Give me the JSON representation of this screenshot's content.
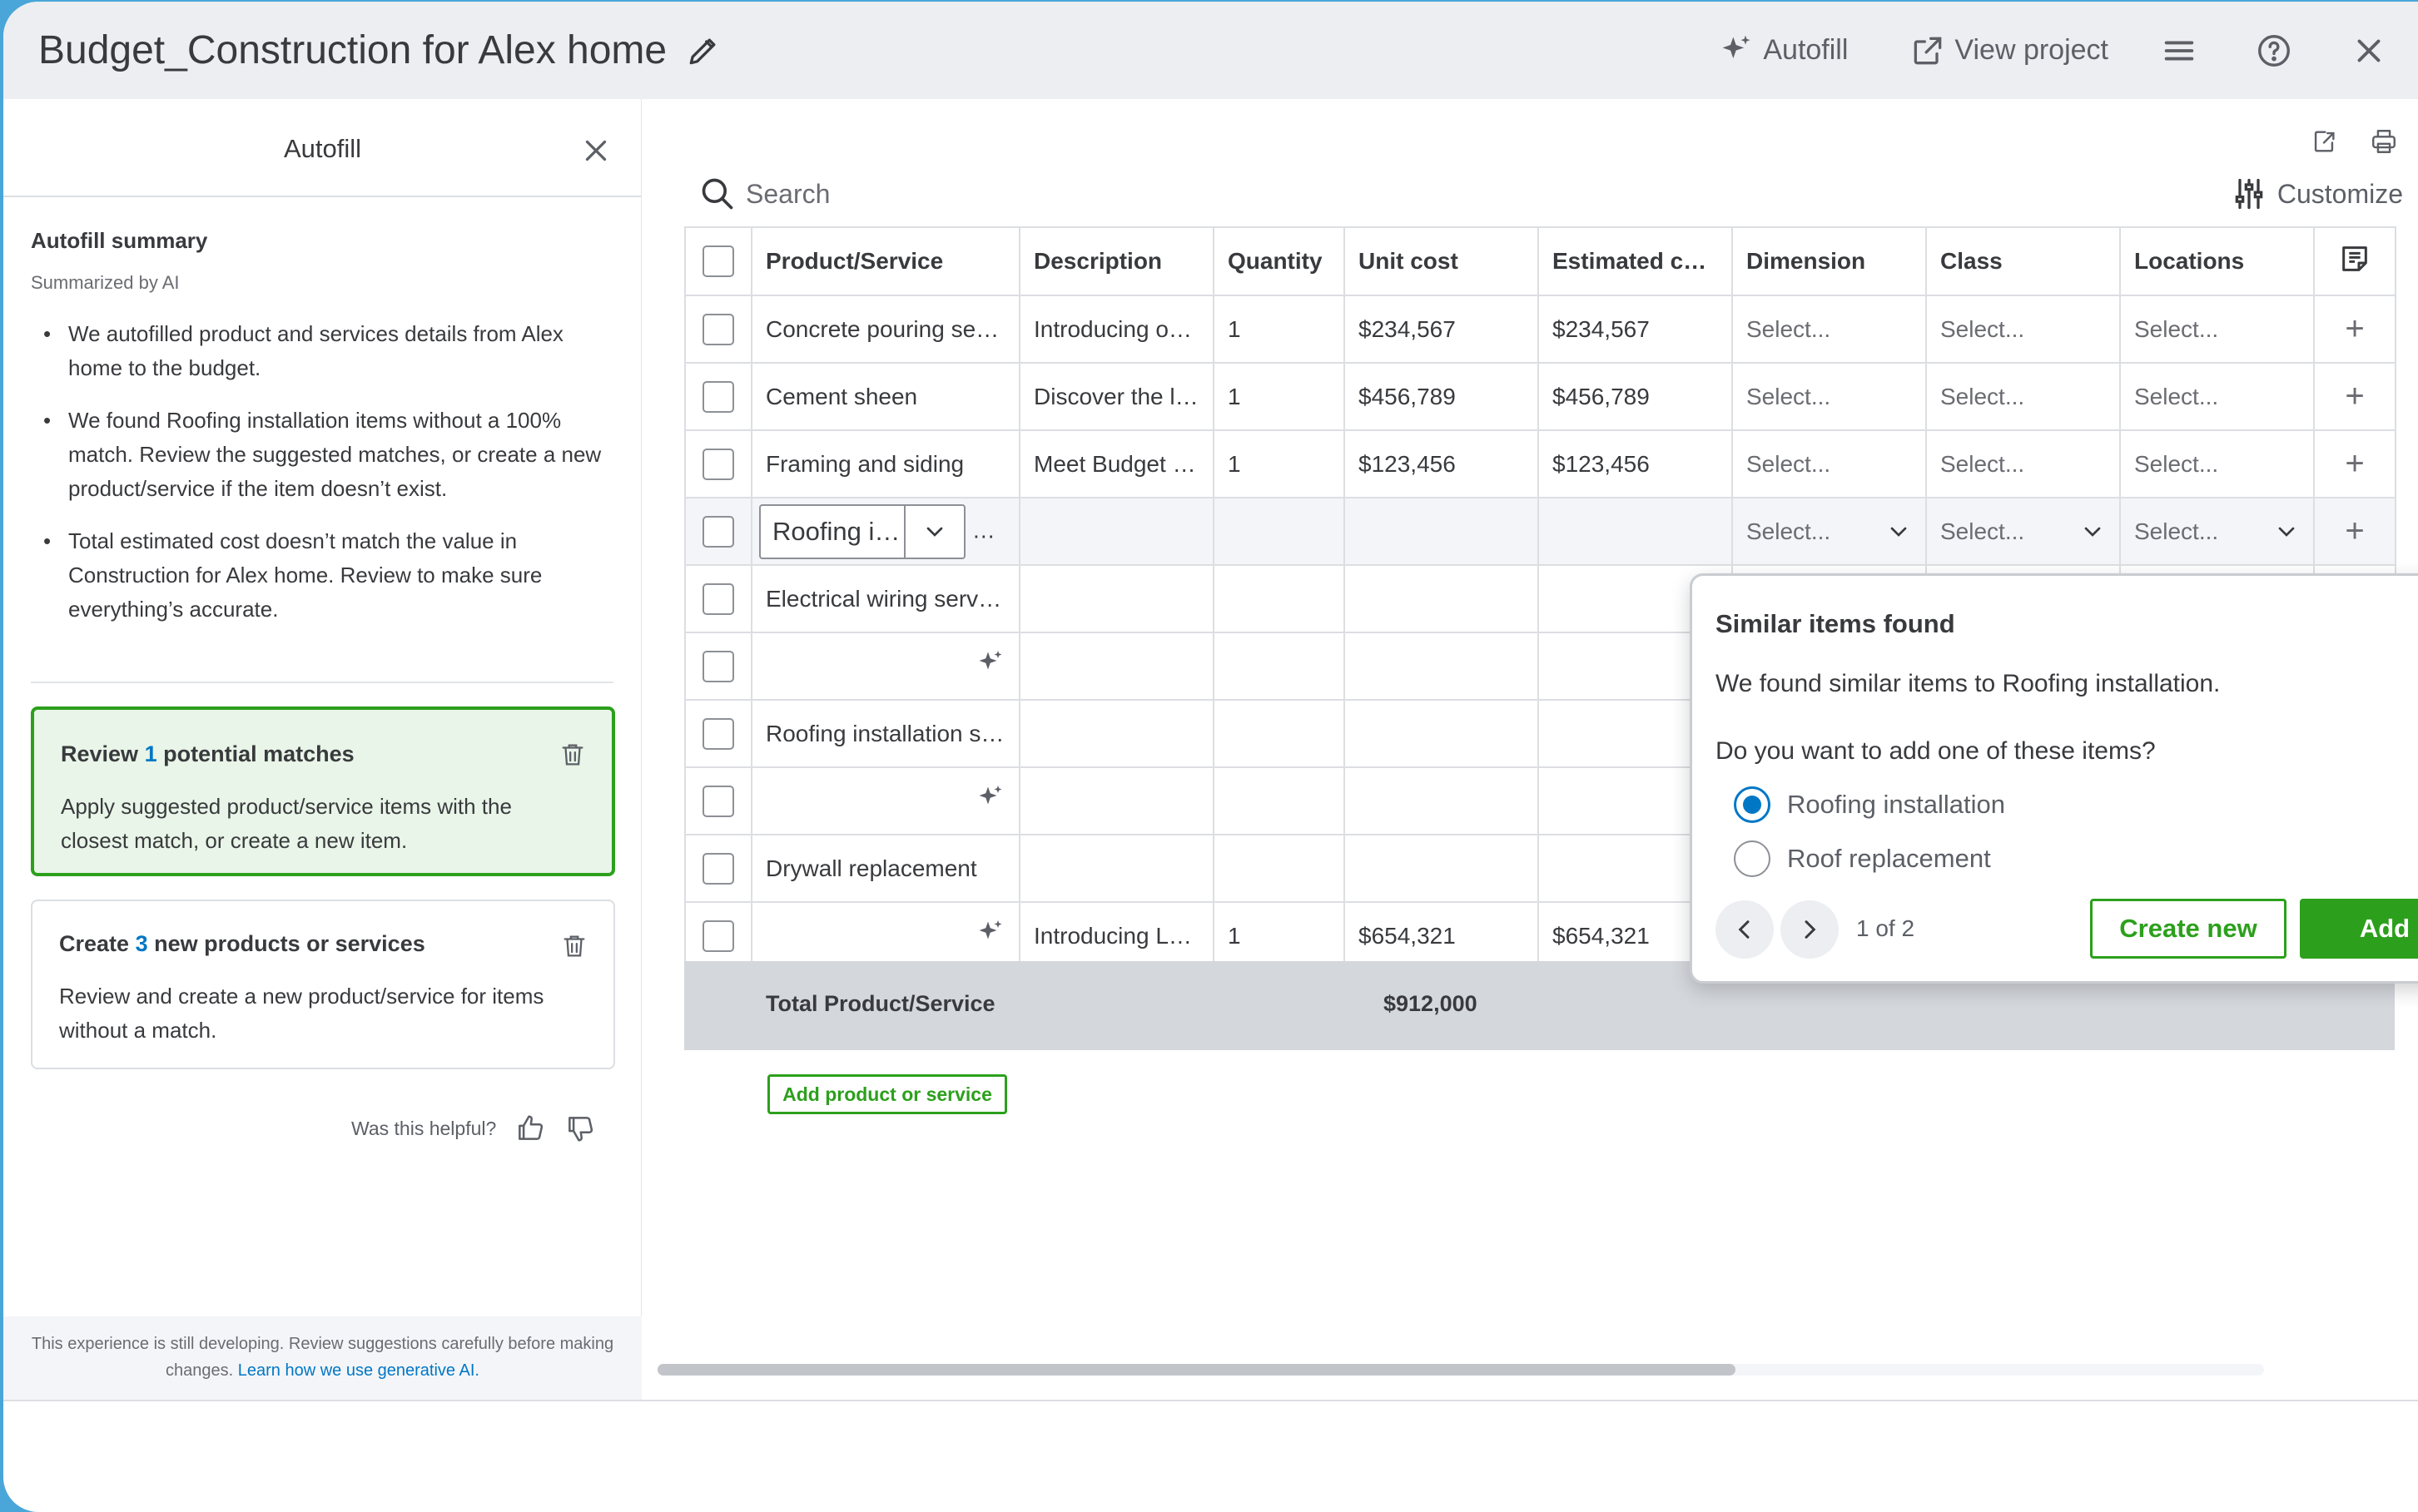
{
  "window": {
    "title": "Budget_Construction for Alex home",
    "actions": {
      "autofill": "Autofill",
      "view_project": "View project"
    }
  },
  "autofill_panel": {
    "title": "Autofill",
    "summary_title": "Autofill summary",
    "summary_subtitle": "Summarized by AI",
    "bullets": [
      "We autofilled product and services details from Alex home to the budget.",
      "We found Roofing installation items without a 100% match. Review the suggested matches, or create a new product/service if the item doesn’t exist.",
      "Total estimated cost doesn’t match the value in Construction for Alex home. Review to make sure everything’s accurate."
    ],
    "review_card": {
      "prefix": "Review",
      "count": "1",
      "suffix": "potential matches",
      "body": "Apply suggested product/service items with the closest match, or create a new item."
    },
    "create_card": {
      "prefix": "Create",
      "count": "3",
      "suffix": "new products or services",
      "body": "Review and create a new product/service for items without a match."
    },
    "helpful_label": "Was this helpful?",
    "footer_text": "This experience is still developing. Review suggestions carefully before making changes.",
    "footer_link": "Learn how we use generative AI."
  },
  "toolbar": {
    "search_placeholder": "Search",
    "customize_label": "Customize"
  },
  "table": {
    "columns": [
      "Product/Service",
      "Description",
      "Quantity",
      "Unit cost",
      "Estimated cost",
      "Dimension",
      "Class",
      "Locations"
    ],
    "select_placeholder": "Select...",
    "rows": [
      {
        "product": "Concrete pouring services",
        "description": "Introducing our premium",
        "quantity": "1",
        "unit_cost": "$234,567",
        "estimated_cost": "$234,567"
      },
      {
        "product": "Cement sheen",
        "description": "Discover the latest",
        "quantity": "1",
        "unit_cost": "$456,789",
        "estimated_cost": "$456,789"
      },
      {
        "product": "Framing and siding",
        "description": "Meet Budget solutions",
        "quantity": "1",
        "unit_cost": "$123,456",
        "estimated_cost": "$123,456"
      },
      {
        "product": "Roofing installation"
      },
      {
        "product": "Electrical wiring services"
      },
      {
        "product": ""
      },
      {
        "product": "Roofing installation services"
      },
      {
        "product": ""
      },
      {
        "product": "Drywall replacement"
      },
      {
        "product": "",
        "description": "Introducing Lorem ipsum",
        "quantity": "1",
        "unit_cost": "$654,321",
        "estimated_cost": "$654,321"
      }
    ],
    "total_label": "Total Product/Service",
    "total_value": "$912,000",
    "add_row_label": "Add product or service"
  },
  "popover": {
    "title": "Similar items found",
    "description": "We found similar items to Roofing installation.",
    "question": "Do you want to add one of these items?",
    "options": [
      "Roofing installation",
      "Roof replacement"
    ],
    "pager": "1 of 2",
    "create_new": "Create new",
    "add": "Add"
  },
  "colors": {
    "brand_green": "#2ca01c",
    "link_blue": "#0077c5",
    "header_bg": "#eceef1",
    "accent_blue": "#2ca8e4"
  }
}
